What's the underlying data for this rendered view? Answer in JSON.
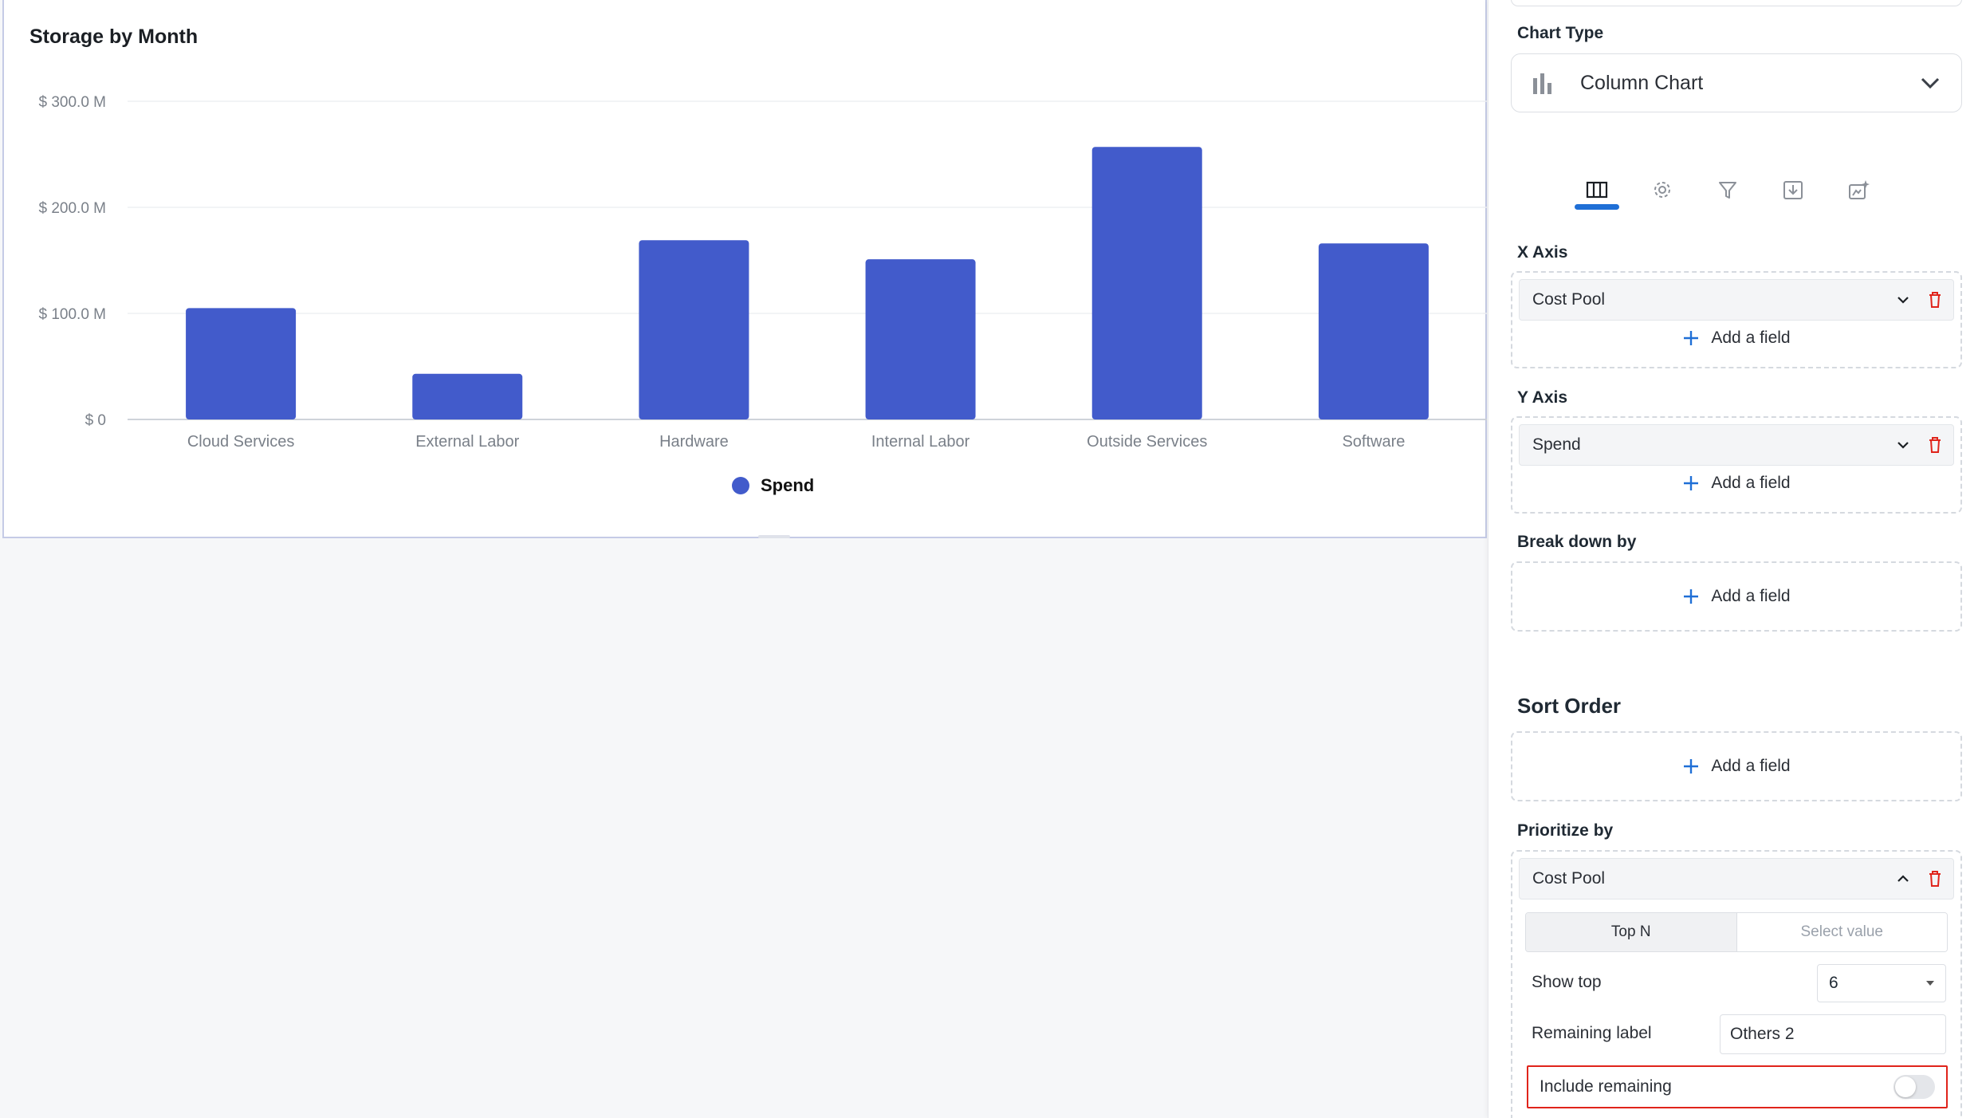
{
  "chart_card": {
    "title": "Storage by Month"
  },
  "chart_data": {
    "type": "bar",
    "title": "Storage by Month",
    "categories": [
      "Cloud Services",
      "External Labor",
      "Hardware",
      "Internal Labor",
      "Outside Services",
      "Software"
    ],
    "series": [
      {
        "name": "Spend",
        "values": [
          105,
          43,
          169,
          151,
          257,
          166
        ]
      }
    ],
    "y_ticks": [
      0,
      100,
      200,
      300
    ],
    "y_tick_labels": [
      "$ 0",
      "$ 100.0 M",
      "$ 200.0 M",
      "$ 300.0 M"
    ],
    "ylim": [
      0,
      300
    ],
    "grid": true,
    "legend": "bottom-center",
    "color": "#425bcb"
  },
  "panel": {
    "chart_type": {
      "label": "Chart Type",
      "value": "Column Chart",
      "icon": "bar-chart-icon"
    },
    "tabs": [
      {
        "id": "columns",
        "icon": "columns-icon",
        "active": true
      },
      {
        "id": "settings",
        "icon": "gear-icon",
        "active": false
      },
      {
        "id": "filter",
        "icon": "filter-icon",
        "active": false
      },
      {
        "id": "download",
        "icon": "download-icon",
        "active": false
      },
      {
        "id": "ai",
        "icon": "ai-sparkle-icon",
        "active": false
      }
    ],
    "x_axis": {
      "label": "X Axis",
      "field": "Cost Pool",
      "add": "Add a field"
    },
    "y_axis": {
      "label": "Y Axis",
      "field": "Spend",
      "add": "Add a field"
    },
    "break_down": {
      "label": "Break down by",
      "add": "Add a field"
    },
    "sort_order": {
      "label": "Sort Order",
      "add": "Add a field"
    },
    "prioritize": {
      "label": "Prioritize by",
      "field": "Cost Pool",
      "segments": [
        "Top N",
        "Select value"
      ],
      "show_top_label": "Show top",
      "show_top_value": "6",
      "remaining_label_label": "Remaining label",
      "remaining_label_value": "Others 2",
      "include_remaining_label": "Include remaining",
      "include_remaining_on": false
    },
    "colors": {
      "accent": "#1f6fd6",
      "danger": "#e0241b",
      "bar": "#425bcb"
    }
  }
}
